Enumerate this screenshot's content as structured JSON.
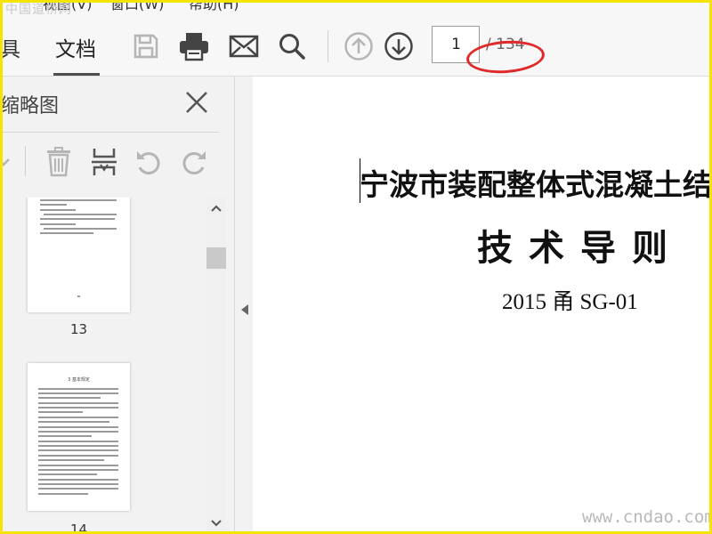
{
  "menubar": {
    "watermark": "中国道桥网",
    "item_view": "视图(V)",
    "item_window": "窗口(W)",
    "item_help": "帮助(H)"
  },
  "toolbar": {
    "tab_tools": "具",
    "tab_document": "文档",
    "buttons": [
      "save-icon",
      "print-icon",
      "email-icon",
      "search-icon",
      "arrow-up-circle-icon",
      "arrow-down-circle-icon"
    ],
    "current_page": "1",
    "total_pages": "/ 134"
  },
  "sidebar": {
    "title": "缩略图",
    "tools": [
      "delete-icon",
      "insert-page-icon",
      "rotate-left-icon",
      "rotate-right-icon"
    ],
    "thumbnails": [
      {
        "label": "13"
      },
      {
        "label": "14",
        "heading": "3 基本规定"
      }
    ]
  },
  "document": {
    "title": "宁波市装配整体式混凝土结",
    "subtitle": "技术导则",
    "code": "2015 甬 SG-01"
  },
  "watermark_bottom": "www.cndao.com",
  "colors": {
    "frame": "#f5e400",
    "annotation": "#e22929",
    "icon_gray": "#444444",
    "icon_disabled": "#b5b5b5"
  }
}
